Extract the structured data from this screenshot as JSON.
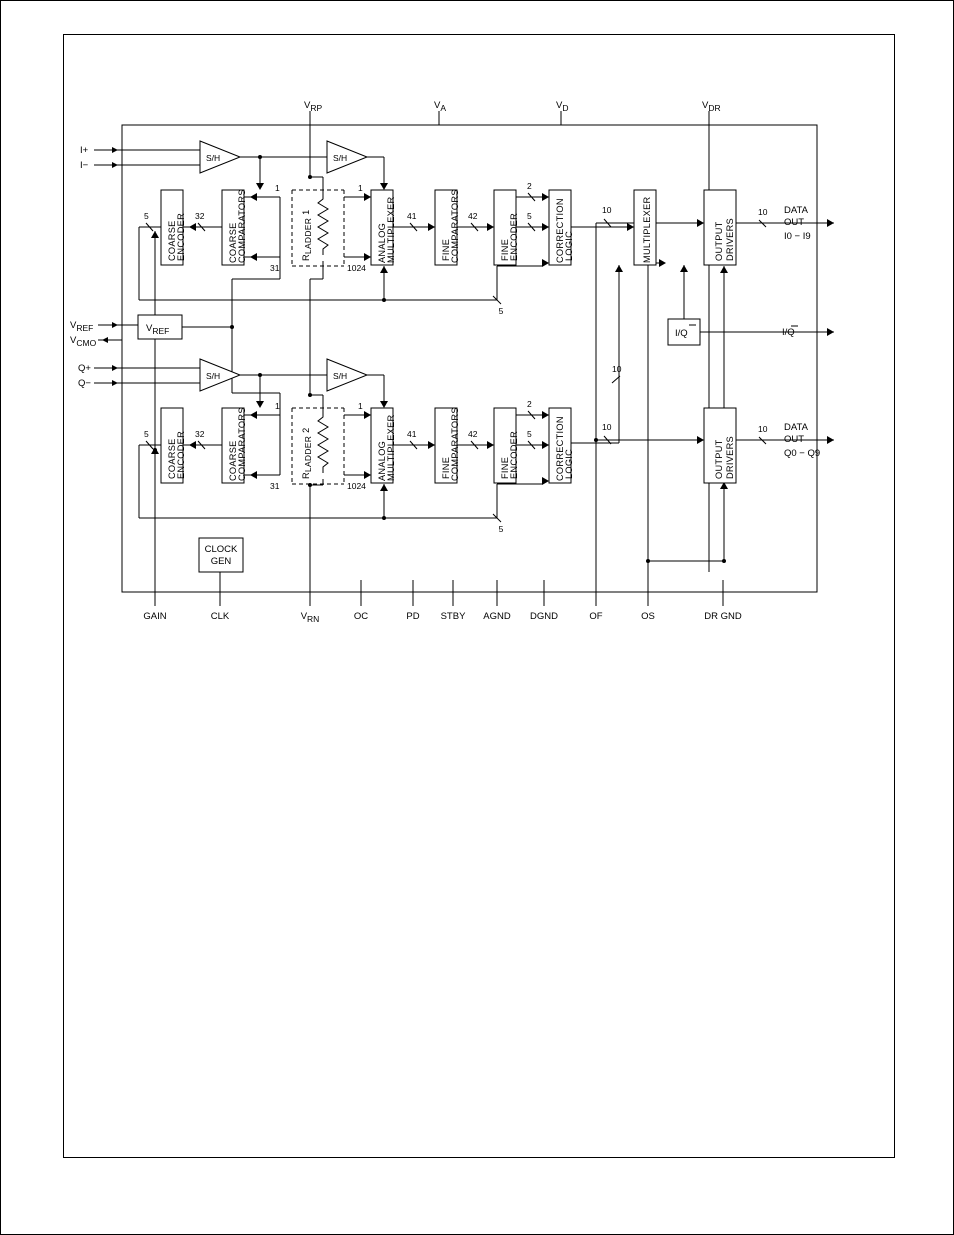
{
  "pins_left": {
    "Iplus": "I+",
    "Iminus": "I−",
    "Vref": "V",
    "Vref_sub": "REF",
    "Vcmo": "V",
    "Vcmo_sub": "CMO",
    "Qplus": "Q+",
    "Qminus": "Q−"
  },
  "pins_top": {
    "Vrp": "V",
    "Vrp_sub": "RP",
    "Va": "V",
    "Va_sub": "A",
    "Vd": "V",
    "Vd_sub": "D",
    "Vdr": "V",
    "Vdr_sub": "DR"
  },
  "pins_right": {
    "data_out_I": "DATA",
    "data_out_I2": "OUT",
    "data_out_I_range": "I0 − I9",
    "IQ": "I/Q",
    "data_out_Q": "DATA",
    "data_out_Q2": "OUT",
    "data_out_Q_range": "Q0 − Q9"
  },
  "pins_bottom": {
    "gain": "GAIN",
    "clk": "CLK",
    "vrn": "V",
    "vrn_sub": "RN",
    "oc": "OC",
    "pd": "PD",
    "stby": "STBY",
    "agnd": "AGND",
    "dgnd": "DGND",
    "of": "OF",
    "os": "OS",
    "drgnd": "DR GND"
  },
  "blocks": {
    "sh": "S/H",
    "coarse_encoder_l1": "COARSE",
    "coarse_encoder_l2": "ENCODER",
    "coarse_comp_l1": "COARSE",
    "coarse_comp_l2": "COMPARATORS",
    "rladder1_l1": "R",
    "rladder1_sub": "LADDER",
    "rladder1_num": "1",
    "rladder2_num": "2",
    "analog_mux_l1": "ANALOG",
    "analog_mux_l2": "MULTIPLEXER",
    "fine_comp_l1": "FINE",
    "fine_comp_l2": "COMPARATORS",
    "fine_enc_l1": "FINE",
    "fine_enc_l2": "ENCODER",
    "corr_l1": "CORRECTION",
    "corr_l2": "LOGIC",
    "mux": "MULTIPLEXER",
    "out_drv_l1": "OUTPUT",
    "out_drv_l2": "DRIVERS",
    "iq_bar": "I/Q̅",
    "vref_box": "V",
    "vref_box_sub": "REF",
    "clkgen_l1": "CLOCK",
    "clkgen_l2": "GEN"
  },
  "nums": {
    "n1": "1",
    "n2": "2",
    "n5": "5",
    "n10": "10",
    "n31": "31",
    "n32": "32",
    "n41": "41",
    "n42": "42",
    "n1024": "1024"
  }
}
